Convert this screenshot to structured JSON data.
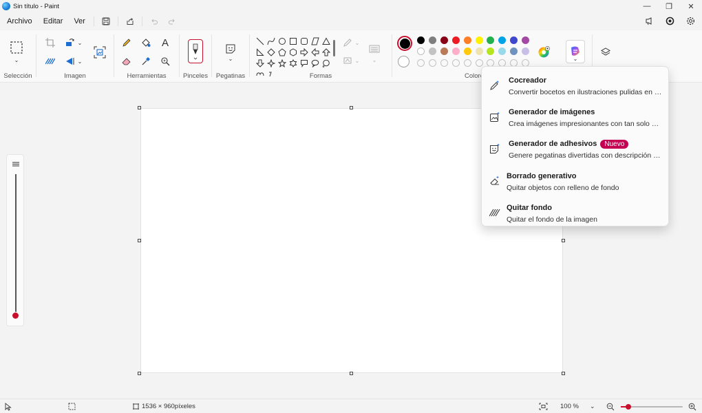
{
  "window": {
    "title": "Sin título - Paint",
    "minimize_icon": "—",
    "restore_icon": "❐",
    "close_icon": "✕"
  },
  "menu": {
    "file": "Archivo",
    "edit": "Editar",
    "view": "Ver"
  },
  "ribbon": {
    "groups": {
      "selection": "Selección",
      "image": "Imagen",
      "tools": "Herramientas",
      "brushes": "Pinceles",
      "stickers": "Pegatinas",
      "shapes": "Formas",
      "colors": "Colores"
    },
    "text_tool_glyph": "A"
  },
  "colors": {
    "accent": "#c8102e",
    "primary": "#000000",
    "secondary": "#ffffff",
    "palette_row1": [
      "#000000",
      "#7f7f7f",
      "#880015",
      "#ed1c24",
      "#ff7f27",
      "#fff200",
      "#22b14c",
      "#00a2e8",
      "#3f48cc",
      "#a349a4"
    ],
    "palette_row2": [
      "#ffffff",
      "#c3c3c3",
      "#b97a57",
      "#ffaec9",
      "#ffc90e",
      "#efe4b0",
      "#b5e61d",
      "#99d9ea",
      "#7092be",
      "#c8bfe7"
    ]
  },
  "copilot_menu": {
    "items": [
      {
        "title": "Cocreador",
        "description": "Convertir bocetos en ilustraciones pulidas en tie...",
        "icon": "pen-sparkle-icon"
      },
      {
        "title": "Generador de imágenes",
        "description": "Crea imágenes impresionantes con tan solo unas...",
        "icon": "image-sparkle-icon"
      },
      {
        "title": "Generador de adhesivos",
        "badge": "Nuevo",
        "description": "Genere pegatinas divertidas con descripción de t...",
        "icon": "sticker-sparkle-icon"
      },
      {
        "title": "Borrado generativo",
        "description": "Quitar objetos con relleno de fondo",
        "icon": "eraser-sparkle-icon"
      },
      {
        "title": "Quitar fondo",
        "description": "Quitar el fondo de la imagen",
        "icon": "remove-background-icon"
      }
    ]
  },
  "status": {
    "canvas_size": "1536 × 960píxeles",
    "zoom": "100 %",
    "zoom_slider_fraction": 0.12
  }
}
